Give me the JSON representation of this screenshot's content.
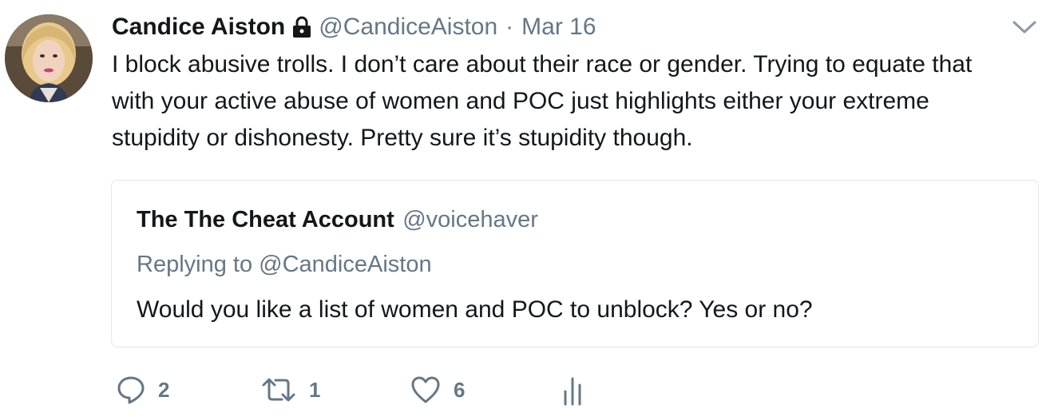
{
  "author": {
    "name": "Candice Aiston",
    "handle": "@CandiceAiston",
    "separator": "·",
    "date": "Mar 16",
    "protected_icon": "lock-icon"
  },
  "tweet": {
    "lines": [
      "I block abusive trolls. I don’t care about their race or gender. Trying to equate that",
      "with your active abuse of women and POC just highlights either your extreme",
      "stupidity or dishonesty. Pretty sure it’s stupidity though."
    ]
  },
  "quoted_tweet": {
    "name": "The The Cheat Account",
    "handle": "@voicehaver",
    "replying_prefix": "Replying to",
    "replying_to": "@CandiceAiston",
    "text": "Would you like a list of women and POC to unblock? Yes or no?"
  },
  "actions": {
    "reply": {
      "icon": "reply-icon",
      "count": "2"
    },
    "retweet": {
      "icon": "retweet-icon",
      "count": "1"
    },
    "like": {
      "icon": "heart-icon",
      "count": "6"
    },
    "analytics": {
      "icon": "analytics-icon"
    }
  },
  "colors": {
    "text": "#14171a",
    "secondary": "#657786",
    "border": "#e1e8ed"
  }
}
